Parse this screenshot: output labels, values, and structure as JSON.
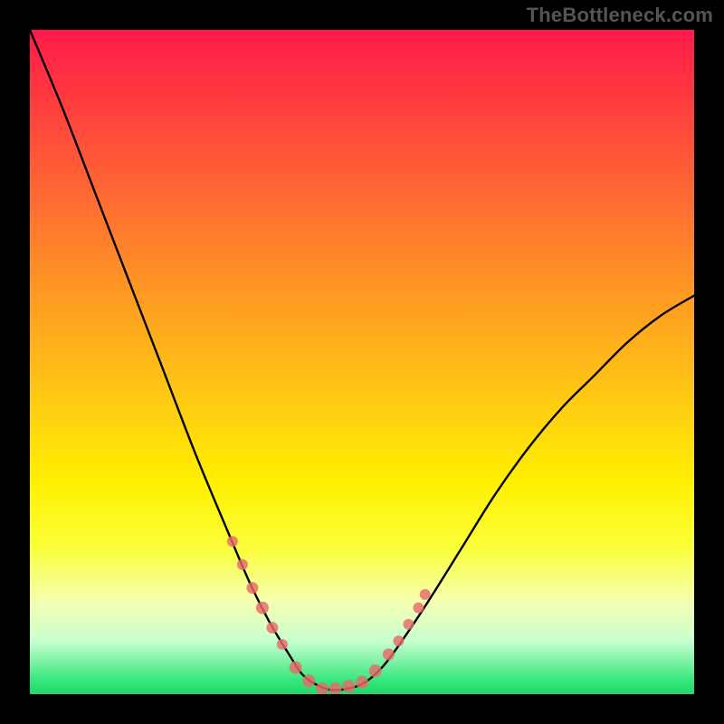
{
  "watermark": "TheBottleneck.com",
  "colors": {
    "frame": "#000000",
    "curve": "#000000",
    "dot": "#e86a6a",
    "gradient_top": "#ff1a4a",
    "gradient_bottom": "#20d86a"
  },
  "chart_data": {
    "type": "line",
    "title": "",
    "xlabel": "",
    "ylabel": "",
    "xlim": [
      0,
      100
    ],
    "ylim": [
      0,
      100
    ],
    "grid": false,
    "legend": false,
    "series": [
      {
        "name": "bottleneck-curve",
        "x": [
          0,
          5,
          10,
          15,
          20,
          25,
          30,
          33,
          36,
          39,
          41,
          43,
          45,
          47,
          50,
          53,
          56,
          60,
          65,
          70,
          75,
          80,
          85,
          90,
          95,
          100
        ],
        "y": [
          100,
          88,
          75,
          62,
          49,
          36,
          24,
          17,
          11,
          6,
          3,
          1.5,
          0.7,
          0.7,
          1.5,
          4,
          8,
          14,
          22,
          30,
          37,
          43,
          48,
          53,
          57,
          60
        ]
      }
    ],
    "markers": {
      "name": "highlight-dots",
      "x": [
        30.5,
        32,
        33.5,
        35,
        36.5,
        38,
        40,
        42,
        44,
        46,
        48,
        50,
        52,
        54,
        55.5,
        57,
        58.5,
        59.5
      ],
      "y": [
        23,
        19.5,
        16,
        13,
        10,
        7.5,
        4,
        2,
        0.8,
        0.8,
        1.2,
        1.8,
        3.5,
        6,
        8,
        10.5,
        13,
        15
      ],
      "r": [
        6,
        6,
        6.5,
        7,
        6.5,
        6,
        7,
        7,
        7,
        7,
        7,
        7,
        7,
        6.5,
        6,
        6,
        6,
        6
      ]
    },
    "notes": "Values estimated from pixel positions; axes have no visible tick labels so x/y are normalized 0–100. Lower y (toward green) indicates balanced/no bottleneck; higher y (toward red) indicates bottleneck."
  }
}
